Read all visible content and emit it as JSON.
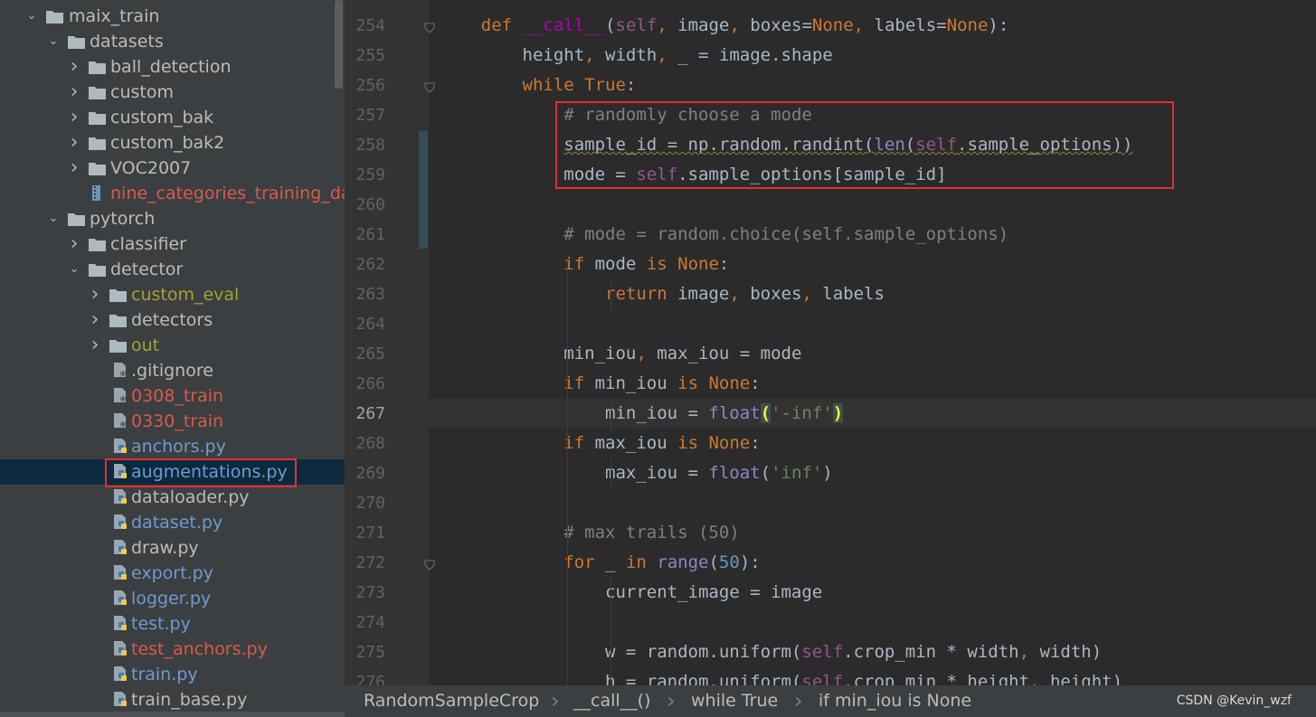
{
  "tree": {
    "items": [
      {
        "label": "maix_train",
        "depth": 0,
        "type": "folder",
        "expanded": true,
        "color": "default"
      },
      {
        "label": "datasets",
        "depth": 1,
        "type": "folder",
        "expanded": true,
        "color": "default"
      },
      {
        "label": "ball_detection",
        "depth": 2,
        "type": "folder",
        "expanded": false,
        "color": "default"
      },
      {
        "label": "custom",
        "depth": 2,
        "type": "folder",
        "expanded": false,
        "color": "default"
      },
      {
        "label": "custom_bak",
        "depth": 2,
        "type": "folder",
        "expanded": false,
        "color": "default"
      },
      {
        "label": "custom_bak2",
        "depth": 2,
        "type": "folder",
        "expanded": false,
        "color": "default"
      },
      {
        "label": "VOC2007",
        "depth": 2,
        "type": "folder",
        "expanded": false,
        "color": "default"
      },
      {
        "label": "nine_categories_training_dat",
        "depth": 2,
        "type": "archive",
        "color": "red"
      },
      {
        "label": "pytorch",
        "depth": 1,
        "type": "folder",
        "expanded": true,
        "color": "default"
      },
      {
        "label": "classifier",
        "depth": 2,
        "type": "folder",
        "expanded": false,
        "color": "default"
      },
      {
        "label": "detector",
        "depth": 2,
        "type": "folder",
        "expanded": true,
        "color": "default"
      },
      {
        "label": "custom_eval",
        "depth": 3,
        "type": "folder",
        "expanded": false,
        "color": "olive"
      },
      {
        "label": "detectors",
        "depth": 3,
        "type": "folder",
        "expanded": false,
        "color": "default"
      },
      {
        "label": "out",
        "depth": 3,
        "type": "folder",
        "expanded": false,
        "color": "olive"
      },
      {
        "label": ".gitignore",
        "depth": 4,
        "type": "file",
        "color": "default"
      },
      {
        "label": "0308_train",
        "depth": 4,
        "type": "file",
        "color": "red"
      },
      {
        "label": "0330_train",
        "depth": 4,
        "type": "file",
        "color": "red"
      },
      {
        "label": "anchors.py",
        "depth": 4,
        "type": "py",
        "color": "blue"
      },
      {
        "label": "augmentations.py",
        "depth": 4,
        "type": "py",
        "color": "blue",
        "selected": true
      },
      {
        "label": "dataloader.py",
        "depth": 4,
        "type": "py",
        "color": "default"
      },
      {
        "label": "dataset.py",
        "depth": 4,
        "type": "py",
        "color": "blue"
      },
      {
        "label": "draw.py",
        "depth": 4,
        "type": "py",
        "color": "default"
      },
      {
        "label": "export.py",
        "depth": 4,
        "type": "py",
        "color": "blue"
      },
      {
        "label": "logger.py",
        "depth": 4,
        "type": "py",
        "color": "blue"
      },
      {
        "label": "test.py",
        "depth": 4,
        "type": "py",
        "color": "blue"
      },
      {
        "label": "test_anchors.py",
        "depth": 4,
        "type": "py",
        "color": "red"
      },
      {
        "label": "train.py",
        "depth": 4,
        "type": "py",
        "color": "blue"
      },
      {
        "label": "train_base.py",
        "depth": 4,
        "type": "py",
        "color": "default"
      }
    ]
  },
  "editor": {
    "current_line": 267,
    "lines": [
      {
        "n": 254,
        "fold": true,
        "segs": [
          [
            "",
            "    "
          ],
          [
            "kw",
            "def "
          ],
          [
            "dunder",
            "__call__"
          ],
          [
            "",
            "("
          ],
          [
            "self",
            "self"
          ],
          [
            "kw",
            ", "
          ],
          [
            "",
            "image"
          ],
          [
            "kw",
            ", "
          ],
          [
            "",
            "boxes="
          ],
          [
            "none",
            "None"
          ],
          [
            "kw",
            ", "
          ],
          [
            "",
            "labels="
          ],
          [
            "none",
            "None"
          ],
          [
            "",
            "):"
          ]
        ]
      },
      {
        "n": 255,
        "segs": [
          [
            "",
            "        height"
          ],
          [
            "kw",
            ", "
          ],
          [
            "",
            "width"
          ],
          [
            "kw",
            ", "
          ],
          [
            "",
            "_ = image.shape"
          ]
        ]
      },
      {
        "n": 256,
        "fold": true,
        "segs": [
          [
            "",
            "        "
          ],
          [
            "kw",
            "while "
          ],
          [
            "kw",
            "True"
          ],
          [
            "",
            ":"
          ]
        ]
      },
      {
        "n": 257,
        "segs": [
          [
            "",
            "            "
          ],
          [
            "cmt",
            "# randomly choose a mode"
          ]
        ]
      },
      {
        "n": 258,
        "segs": [
          [
            "",
            "            "
          ],
          [
            "sq",
            "sample_id = np.random.randint("
          ],
          [
            "bi sq",
            "len"
          ],
          [
            "sq",
            "("
          ],
          [
            "self sq",
            "self"
          ],
          [
            "sq",
            ".sample_options))"
          ]
        ]
      },
      {
        "n": 259,
        "segs": [
          [
            "",
            "            mode = "
          ],
          [
            "self",
            "self"
          ],
          [
            "",
            ".sample_options[sample_id]"
          ]
        ]
      },
      {
        "n": 260,
        "segs": []
      },
      {
        "n": 261,
        "segs": [
          [
            "",
            "            "
          ],
          [
            "cmt",
            "# mode = random.choice(self.sample_options)"
          ]
        ]
      },
      {
        "n": 262,
        "segs": [
          [
            "",
            "            "
          ],
          [
            "kw",
            "if "
          ],
          [
            "",
            "mode "
          ],
          [
            "kw",
            "is "
          ],
          [
            "none",
            "None"
          ],
          [
            "",
            ":"
          ]
        ]
      },
      {
        "n": 263,
        "segs": [
          [
            "",
            "                "
          ],
          [
            "kw",
            "return "
          ],
          [
            "",
            "image"
          ],
          [
            "kw",
            ", "
          ],
          [
            "",
            "boxes"
          ],
          [
            "kw",
            ", "
          ],
          [
            "",
            "labels"
          ]
        ]
      },
      {
        "n": 264,
        "segs": []
      },
      {
        "n": 265,
        "segs": [
          [
            "",
            "            min_iou"
          ],
          [
            "kw",
            ", "
          ],
          [
            "",
            "max_iou = mode"
          ]
        ]
      },
      {
        "n": 266,
        "segs": [
          [
            "",
            "            "
          ],
          [
            "kw",
            "if "
          ],
          [
            "",
            "min_iou "
          ],
          [
            "kw",
            "is "
          ],
          [
            "none",
            "None"
          ],
          [
            "",
            ":"
          ]
        ]
      },
      {
        "n": 267,
        "segs": [
          [
            "",
            "                min_iou = "
          ],
          [
            "bi",
            "float"
          ],
          [
            "paren-match",
            "("
          ],
          [
            "str",
            "'-inf'"
          ],
          [
            "paren-match",
            ")"
          ]
        ]
      },
      {
        "n": 268,
        "segs": [
          [
            "",
            "            "
          ],
          [
            "kw",
            "if "
          ],
          [
            "",
            "max_iou "
          ],
          [
            "kw",
            "is "
          ],
          [
            "none",
            "None"
          ],
          [
            "",
            ":"
          ]
        ]
      },
      {
        "n": 269,
        "segs": [
          [
            "",
            "                max_iou = "
          ],
          [
            "bi",
            "float"
          ],
          [
            "",
            "("
          ],
          [
            "str",
            "'inf'"
          ],
          [
            "",
            ")"
          ]
        ]
      },
      {
        "n": 270,
        "segs": []
      },
      {
        "n": 271,
        "segs": [
          [
            "",
            "            "
          ],
          [
            "cmt",
            "# max trails (50)"
          ]
        ]
      },
      {
        "n": 272,
        "fold": true,
        "segs": [
          [
            "",
            "            "
          ],
          [
            "kw",
            "for "
          ],
          [
            "",
            "_ "
          ],
          [
            "kw",
            "in "
          ],
          [
            "bi",
            "range"
          ],
          [
            "",
            "("
          ],
          [
            "num",
            "50"
          ],
          [
            "",
            "):"
          ]
        ]
      },
      {
        "n": 273,
        "segs": [
          [
            "",
            "                current_image = image"
          ]
        ]
      },
      {
        "n": 274,
        "segs": []
      },
      {
        "n": 275,
        "segs": [
          [
            "",
            "                w = random.uniform("
          ],
          [
            "self",
            "self"
          ],
          [
            "",
            ".crop_min * width"
          ],
          [
            "kw",
            ", "
          ],
          [
            "",
            "width)"
          ]
        ]
      },
      {
        "n": 276,
        "segs": [
          [
            "",
            "                h = random.uniform("
          ],
          [
            "self",
            "self"
          ],
          [
            "",
            ".crop_min * height"
          ],
          [
            "kw",
            ", "
          ],
          [
            "",
            "height)"
          ]
        ]
      }
    ]
  },
  "breadcrumbs": [
    "RandomSampleCrop",
    "__call__()",
    "while True",
    "if min_iou is None"
  ],
  "watermark": "CSDN @Kevin_wzf",
  "colors": {
    "highlight_box": "#e03030",
    "selection": "#0d293e"
  }
}
